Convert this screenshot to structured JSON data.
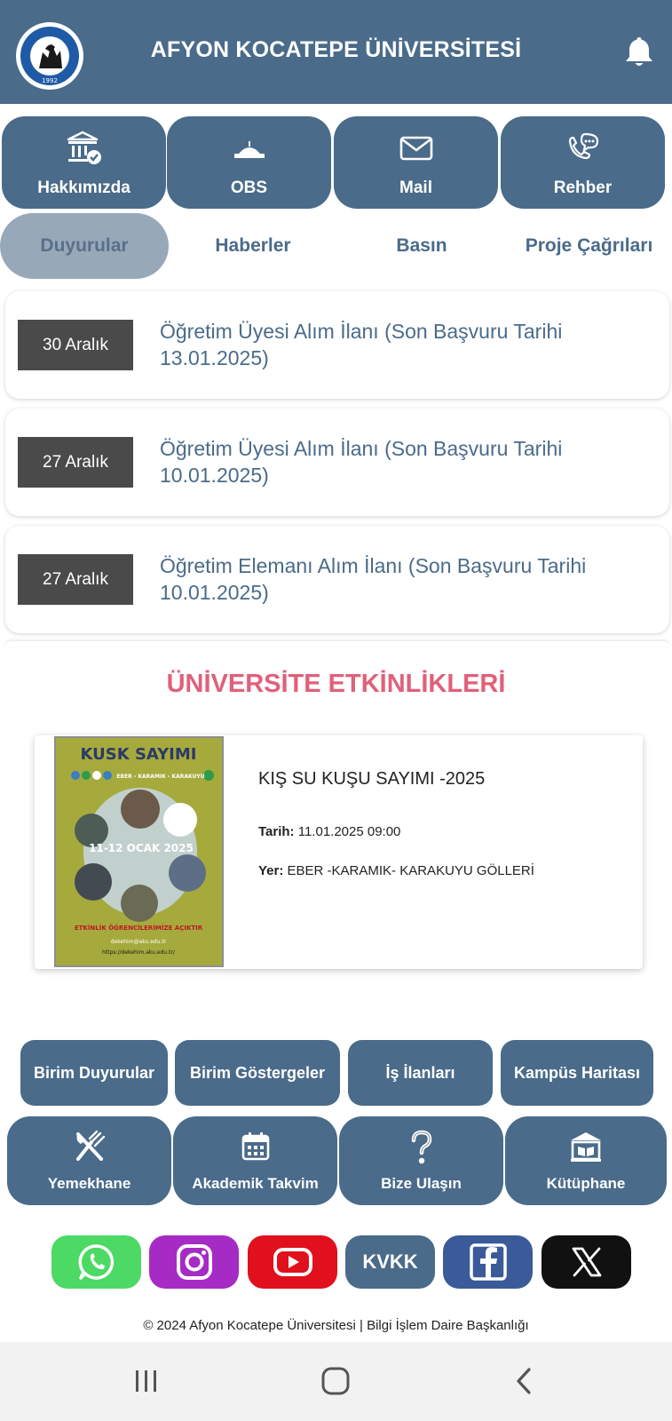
{
  "header": {
    "title": "AFYON KOCATEPE ÜNİVERSİTESİ",
    "logo_text_top": "AFYON KOCATEPE ÜNİVERSİTESİ",
    "logo_year": "1992"
  },
  "quick_links": [
    {
      "label": "Hakkımızda",
      "icon": "university-check-icon"
    },
    {
      "label": "OBS",
      "icon": "building-icon"
    },
    {
      "label": "Mail",
      "icon": "envelope-icon"
    },
    {
      "label": "Rehber",
      "icon": "phone-chat-icon"
    }
  ],
  "tabs": [
    {
      "label": "Duyurular",
      "active": true
    },
    {
      "label": "Haberler",
      "active": false
    },
    {
      "label": "Basın",
      "active": false
    },
    {
      "label": "Proje Çağrıları",
      "active": false
    }
  ],
  "announcements": [
    {
      "date": "30 Aralık",
      "title": "Öğretim Üyesi Alım İlanı (Son Başvuru Tarihi 13.01.2025)"
    },
    {
      "date": "27 Aralık",
      "title": "Öğretim Üyesi Alım İlanı (Son Başvuru Tarihi 10.01.2025)"
    },
    {
      "date": "27 Aralık",
      "title": "Öğretim Elemanı Alım İlanı (Son Başvuru Tarihi 10.01.2025)"
    }
  ],
  "events_section": {
    "title": "ÜNİVERSİTE ETKİNLİKLERİ"
  },
  "event": {
    "title": "KIŞ SU KUŞU SAYIMI -2025",
    "date_label": "Tarih:",
    "date_value": "11.01.2025 09:00",
    "place_label": "Yer:",
    "place_value": "EBER -KARAMIK- KARAKUYU GÖLLERİ",
    "poster": {
      "heading": "KUSK SAYIMI",
      "sub": "EBER - KARAMIK - KARAKUYU",
      "dates": "11-12 OCAK 2025",
      "note": "ETKİNLİK ÖĞRENCİLERİMİZE AÇIKTIR",
      "email": "dekehim@aku.edu.tr",
      "url": "https://dekehim.aku.edu.tr/"
    }
  },
  "link_buttons": [
    {
      "label": "Birim Duyurular"
    },
    {
      "label": "Birim Göstergeler"
    },
    {
      "label": "İş İlanları"
    },
    {
      "label": "Kampüs Haritası"
    }
  ],
  "big_buttons": [
    {
      "label": "Yemekhane",
      "icon": "fork-knife-icon"
    },
    {
      "label": "Akademik Takvim",
      "icon": "calendar-icon"
    },
    {
      "label": "Bize Ulaşın",
      "icon": "question-icon"
    },
    {
      "label": "Kütüphane",
      "icon": "library-icon"
    }
  ],
  "social": {
    "kvkk_label": "KVKK",
    "colors": {
      "whatsapp": "#4cd964",
      "instagram": "#a62bc5",
      "youtube": "#e0101d",
      "kvkk": "#4a6b8a",
      "facebook": "#3b5a99",
      "x": "#111111"
    }
  },
  "footer": {
    "text": "© 2024 Afyon Kocatepe Üniversitesi | Bilgi İşlem Daire Başkanlığı"
  },
  "colors": {
    "primary": "#4a6b8a",
    "accent": "#e0607a"
  }
}
